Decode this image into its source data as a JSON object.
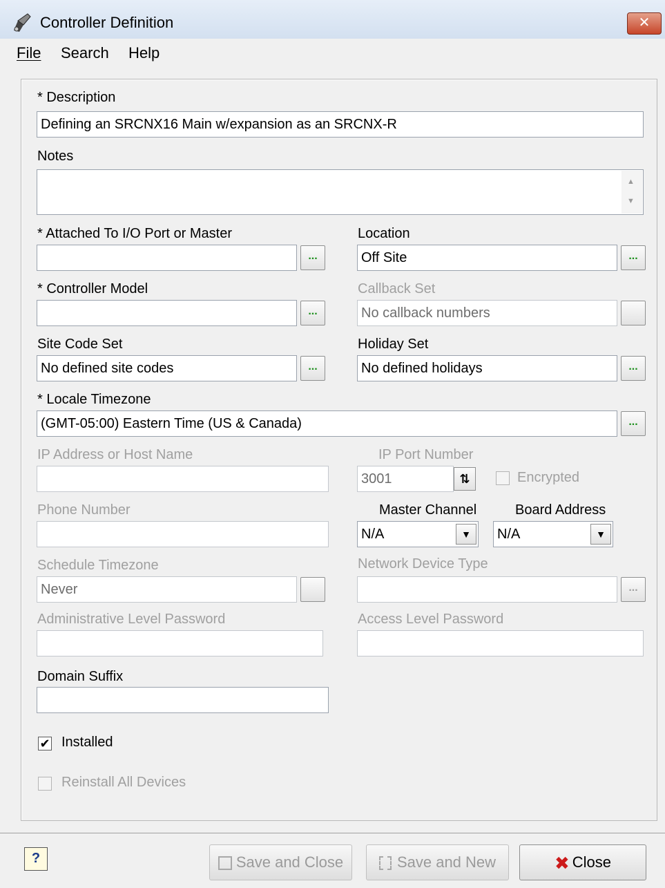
{
  "window": {
    "title": "Controller Definition",
    "close_glyph": "✕"
  },
  "menu": {
    "file": "File",
    "search": "Search",
    "help": "Help"
  },
  "form": {
    "description": {
      "label": "* Description",
      "value": "Defining an SRCNX16 Main w/expansion as an SRCNX-R"
    },
    "notes": {
      "label": "Notes",
      "value": ""
    },
    "attached": {
      "label": "* Attached To I/O Port or Master",
      "value": ""
    },
    "location": {
      "label": "Location",
      "value": "Off Site"
    },
    "controller_model": {
      "label": "* Controller Model",
      "value": ""
    },
    "callback_set": {
      "label": "Callback Set",
      "value": "No callback numbers"
    },
    "site_code_set": {
      "label": "Site Code Set",
      "value": "No defined site codes"
    },
    "holiday_set": {
      "label": "Holiday Set",
      "value": "No defined holidays"
    },
    "locale_timezone": {
      "label": "* Locale Timezone",
      "value": "(GMT-05:00) Eastern Time (US & Canada)"
    },
    "ip_address": {
      "label": "IP Address or Host Name",
      "value": ""
    },
    "ip_port": {
      "label": "IP Port Number",
      "value": "3001"
    },
    "encrypted": {
      "label": "Encrypted",
      "checked": false
    },
    "phone": {
      "label": "Phone Number",
      "value": ""
    },
    "master_channel": {
      "label": "Master Channel",
      "value": "N/A"
    },
    "board_address": {
      "label": "Board Address",
      "value": "N/A"
    },
    "schedule_timezone": {
      "label": "Schedule Timezone",
      "value": "Never"
    },
    "network_device_type": {
      "label": "Network Device Type",
      "value": ""
    },
    "admin_password": {
      "label": "Administrative Level Password",
      "value": ""
    },
    "access_password": {
      "label": "Access Level Password",
      "value": ""
    },
    "domain_suffix": {
      "label": "Domain Suffix",
      "value": ""
    },
    "installed": {
      "label": "Installed",
      "checked": true
    },
    "reinstall": {
      "label": "Reinstall All Devices",
      "checked": false
    },
    "ellipsis": "...",
    "check_mark": "✔",
    "dropdown_glyph": "▼"
  },
  "buttons": {
    "help_glyph": "?",
    "save_close": "Save and Close",
    "save_new": "Save and New",
    "close": "Close",
    "close_glyph": "✖"
  }
}
